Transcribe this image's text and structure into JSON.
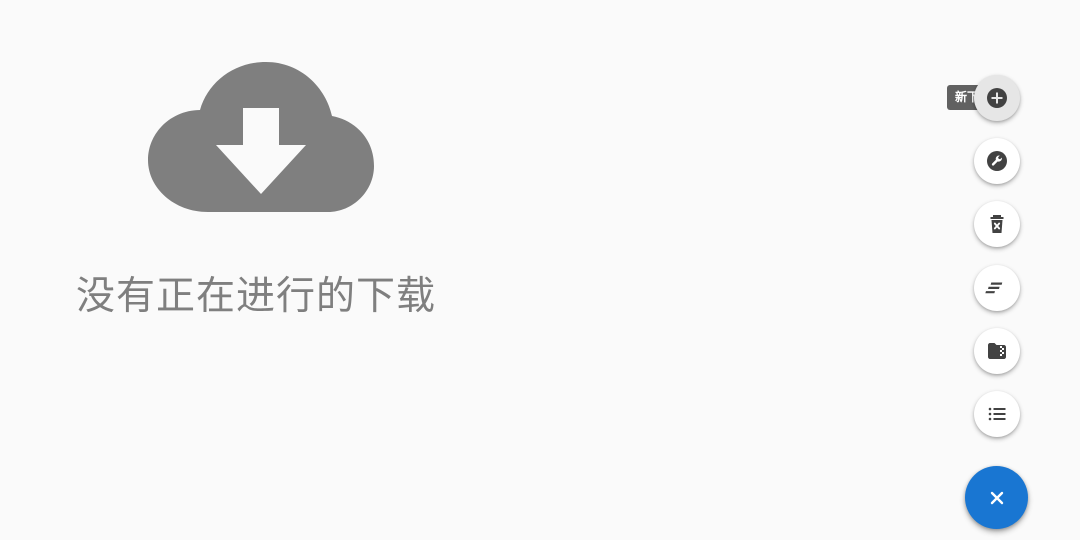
{
  "empty_state": {
    "icon": "cloud-download-icon",
    "message": "没有正在进行的下载"
  },
  "fab_menu": {
    "actions": [
      {
        "icon": "add-circle-icon",
        "tooltip": "新下载"
      },
      {
        "icon": "wrench-icon"
      },
      {
        "icon": "delete-icon"
      },
      {
        "icon": "notes-icon"
      },
      {
        "icon": "folder-zip-icon"
      },
      {
        "icon": "list-icon"
      }
    ],
    "main_icon": "close-icon"
  },
  "colors": {
    "background": "#fafafa",
    "icon_gray": "#7f7f7f",
    "dark_icon": "#424242",
    "tooltip_bg": "#616161",
    "accent": "#1976d2"
  }
}
